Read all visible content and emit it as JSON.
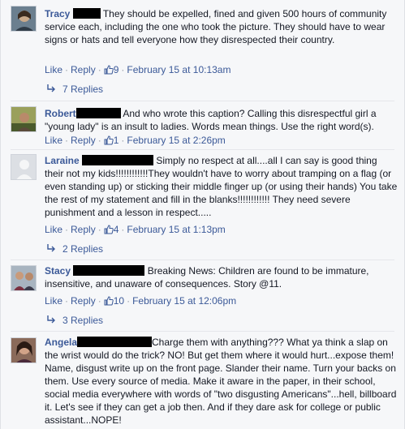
{
  "comments": [
    {
      "name": "Tracy",
      "text": "They should be expelled, fined and given 500 hours of community service each, including the one who took the picture. They should have to wear signs or hats and tell everyone how they disrespected their country.",
      "like": "Like",
      "reply": "Reply",
      "likes": "9",
      "time": "February 15 at 10:13am",
      "replies": "7 Replies"
    },
    {
      "name": "Robert",
      "text": "And who wrote this caption? Calling this disrespectful girl a \"young lady\" is an insult to ladies. Words mean things. Use the right word(s).",
      "like": "Like",
      "reply": "Reply",
      "likes": "1",
      "time": "February 15 at 2:26pm"
    },
    {
      "name": "Laraine",
      "text": "Simply no respect at all....all I can say is good thing their not my kids!!!!!!!!!!!!They wouldn't have to worry about tramping on a flag (or even standing up) or sticking their middle finger up (or using their hands) You take the rest of my statement and fill in the blanks!!!!!!!!!!!! They need severe punishment and a lesson in respect.....",
      "like": "Like",
      "reply": "Reply",
      "likes": "4",
      "time": "February 15 at 1:13pm",
      "replies": "2 Replies"
    },
    {
      "name": "Stacy",
      "text": "Breaking News: Children are found to be immature, insensitive, and unaware of consequences. Story @11.",
      "like": "Like",
      "reply": "Reply",
      "likes": "10",
      "time": "February 15 at 12:06pm",
      "replies": "3 Replies"
    },
    {
      "name": "Angela",
      "text": "Charge them with anything??? What ya think a slap on the wrist would do the trick? NO! But get them where it would hurt...expose them! Name, disgust write up on the front page. Slander their name. Turn your backs on them. Use every source of media. Make it aware in the paper, in their school, social media everywhere with words of \"two disgusting Americans\"...hell, billboard it. Let's see if they can get a job then. And if they dare ask for college or public assistant...NOPE!"
    }
  ],
  "colors": {
    "link": "#3b5998",
    "meta": "#9197a3",
    "text": "#141823",
    "background": "#f6f7f9"
  },
  "icons": {
    "like": "thumbs-up-icon",
    "reply": "reply-arrow-icon"
  }
}
